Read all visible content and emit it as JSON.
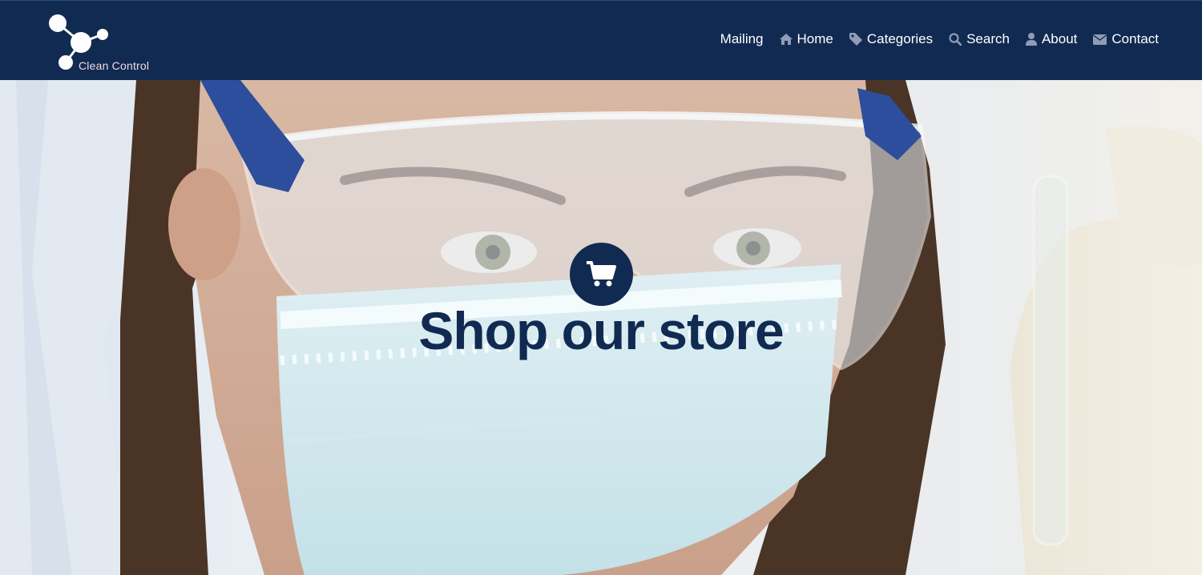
{
  "brand": {
    "name": "Clean Control",
    "logo_icon": "molecule-icon",
    "header_color": "#112a52",
    "accent_color": "#112a52"
  },
  "nav": {
    "items": [
      {
        "label": "Mailing",
        "icon": ""
      },
      {
        "label": "Home",
        "icon": "home-icon"
      },
      {
        "label": "Categories",
        "icon": "tag-icon"
      },
      {
        "label": "Search",
        "icon": "search-icon"
      },
      {
        "label": "About",
        "icon": "user-icon"
      },
      {
        "label": "Contact",
        "icon": "envelope-icon"
      }
    ]
  },
  "hero": {
    "icon": "shopping-cart-icon",
    "title": "Shop our store"
  }
}
